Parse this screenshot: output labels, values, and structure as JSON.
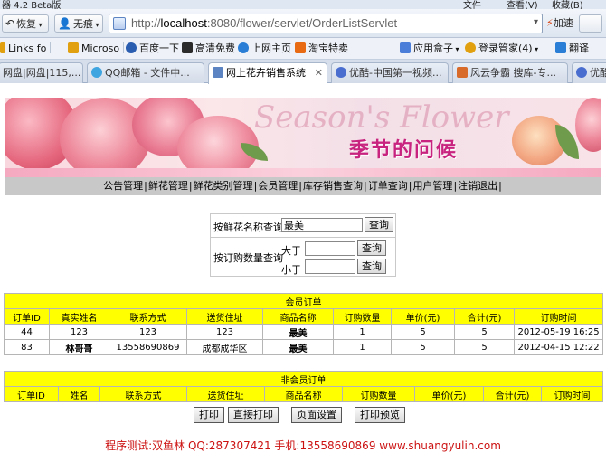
{
  "browser": {
    "app_title": "器 4.2 Beta版",
    "menu": [
      "文件",
      "查看(V)",
      "收藏(B)"
    ],
    "toolbar": {
      "restore_label": "恢复",
      "incognito_label": "无痕",
      "address": {
        "prefix": "http://",
        "host": "localhost",
        "rest": ":8080/flower/servlet/OrderListServlet"
      },
      "accelerate_label": "加速"
    },
    "favorites": [
      {
        "label": "Links fo",
        "color": "#e0a010"
      },
      {
        "label": "Microso",
        "color": "#e0a010"
      },
      {
        "label": "百度一下",
        "color": "#2a5db0"
      },
      {
        "label": "高清免费",
        "color": "#2b2b2b"
      },
      {
        "label": "上网主页",
        "color": "#2a7ed6"
      },
      {
        "label": "淘宝特卖",
        "color": "#e86a12"
      },
      {
        "label": "应用盒子",
        "color": "#4a7ed8"
      },
      {
        "label": "登录管家(4)",
        "color": "#e0a010"
      },
      {
        "label": "翻译",
        "color": "#2a7ed6"
      }
    ],
    "tabs": [
      {
        "label": "网盘|网盘|115,...",
        "color": "#2a7ed6"
      },
      {
        "label": "QQ邮箱 - 文件中...",
        "color": "#3fa5e0"
      },
      {
        "label": "网上花卉销售系统",
        "color": "#5c84c2",
        "active": true
      },
      {
        "label": "优酷-中国第一视频...",
        "color": "#4a6ed0"
      },
      {
        "label": "风云争霸 搜库-专...",
        "color": "#d86a2a"
      },
      {
        "label": "优酷",
        "color": "#4a6ed0"
      }
    ]
  },
  "banner": {
    "script_text": "Season's Flower",
    "title": "季节的问候"
  },
  "nav": {
    "items": [
      "公告管理",
      "鲜花管理",
      "鲜花类别管理",
      "会员管理",
      "库存销售查询",
      "订单查询",
      "用户管理",
      "注销退出"
    ],
    "separator": "|"
  },
  "query": {
    "by_name_label": "按鲜花名称查询",
    "name_value": "最美",
    "search_label": "查询",
    "by_qty_label": "按订购数量查询",
    "greater_label": "大于",
    "less_label": "小于",
    "greater_value": "",
    "less_value": ""
  },
  "member_orders": {
    "caption": "会员订单",
    "columns": [
      "订单ID",
      "真实姓名",
      "联系方式",
      "送货住址",
      "商品名称",
      "订购数量",
      "单价(元)",
      "合计(元)",
      "订购时间"
    ],
    "rows": [
      [
        "44",
        "123",
        "123",
        "123",
        "最美",
        "1",
        "5",
        "5",
        "2012-05-19 16:25"
      ],
      [
        "83",
        "林哥哥",
        "13558690869",
        "成都成华区",
        "最美",
        "1",
        "5",
        "5",
        "2012-04-15 12:22"
      ]
    ]
  },
  "nonmember_orders": {
    "caption": "非会员订单",
    "columns": [
      "订单ID",
      "姓名",
      "联系方式",
      "送货住址",
      "商品名称",
      "订购数量",
      "单价(元)",
      "合计(元)",
      "订购时间"
    ]
  },
  "actions": {
    "print": "打印",
    "direct_print": "直接打印",
    "page_setup": "页面设置",
    "print_preview": "打印预览"
  },
  "footer": {
    "text": "程序测试:双鱼林 QQ:287307421 手机:13558690869 www.shuangyulin.com"
  },
  "colors": {
    "table_header_bg": "#ffff00",
    "footer_text": "#cc1111",
    "nav_bg": "#c8c8c8",
    "banner_title": "#c8247f"
  }
}
